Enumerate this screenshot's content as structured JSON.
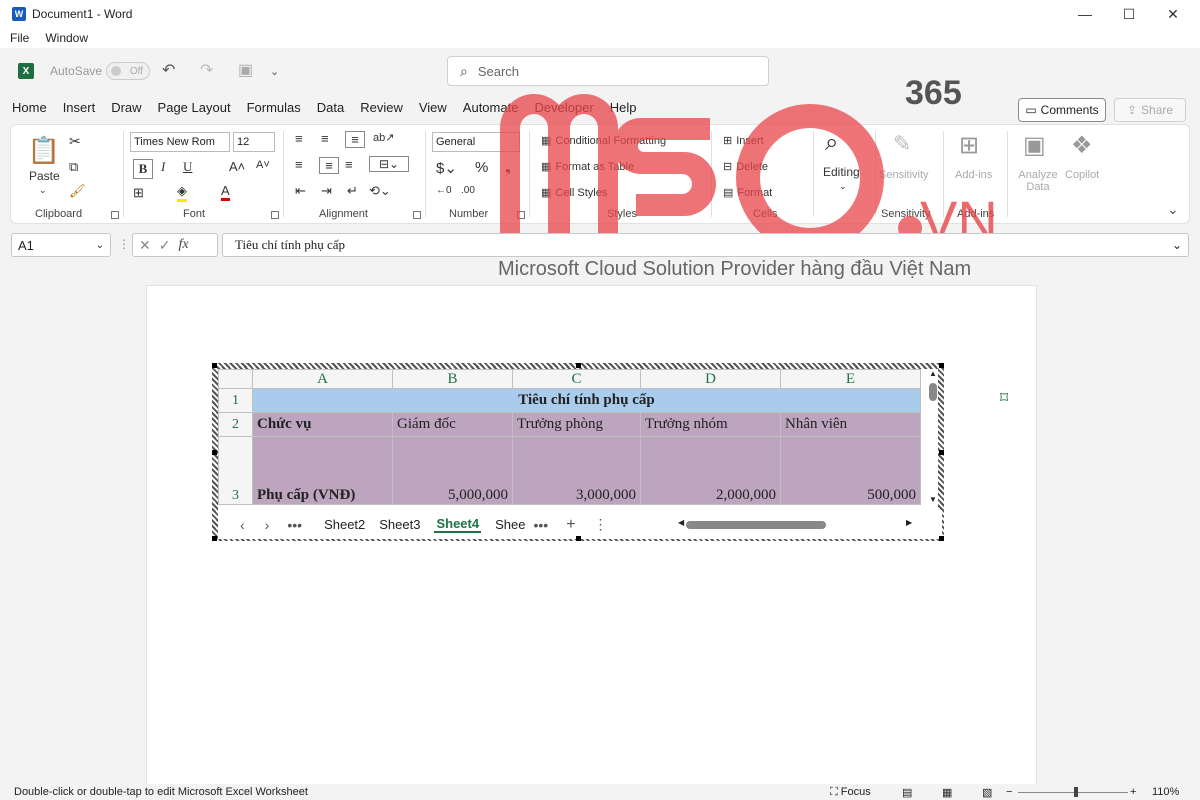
{
  "window": {
    "title": "Document1 - Word",
    "app_letter": "W"
  },
  "menubar": [
    "File",
    "Window"
  ],
  "qat": {
    "autosave": "AutoSave",
    "toggle": "Off",
    "excel_letter": "X"
  },
  "search": {
    "placeholder": "Search"
  },
  "tabs": [
    "Home",
    "Insert",
    "Draw",
    "Page Layout",
    "Formulas",
    "Data",
    "Review",
    "View",
    "Automate",
    "Developer",
    "Help"
  ],
  "comments_label": "Comments",
  "share_label": "Share",
  "ribbon": {
    "clipboard": {
      "paste": "Paste",
      "label": "Clipboard"
    },
    "font": {
      "name": "Times New Rom",
      "size": "12",
      "label": "Font"
    },
    "alignment": {
      "label": "Alignment"
    },
    "number": {
      "format": "General",
      "label": "Number"
    },
    "styles": {
      "cond": "Conditional Formatting",
      "table": "Format as Table",
      "cell": "Cell Styles",
      "label": "Styles"
    },
    "cells": {
      "insert": "Insert",
      "delete": "Delete",
      "format": "Format",
      "label": "Cells"
    },
    "editing": {
      "label": "Editing"
    },
    "sensitivity": {
      "btn": "Sensitivity",
      "label": "Sensitivity"
    },
    "addins": {
      "btn": "Add-ins",
      "label": "Add-ins"
    },
    "analyze": "Analyze Data",
    "copilot": "Copilot"
  },
  "formula_bar": {
    "namebox": "A1",
    "fx": "fx",
    "content": "Tiêu chí tính phụ cấp"
  },
  "watermark": {
    "brand": "mso.vn",
    "suffix": "365",
    "tagline": "Microsoft Cloud Solution Provider hàng đầu Việt Nam"
  },
  "sheet": {
    "columns": [
      "A",
      "B",
      "C",
      "D",
      "E"
    ],
    "rows": [
      "1",
      "2",
      "3"
    ],
    "title": "Tiêu chí tính phụ cấp",
    "header_row": [
      "Chức vụ",
      "Giám đốc",
      "Trưởng phòng",
      "Trưởng nhóm",
      "Nhân viên"
    ],
    "data_row": [
      "Phụ cấp (VNĐ)",
      "5,000,000",
      "3,000,000",
      "2,000,000",
      "500,000"
    ],
    "tabs": [
      "Sheet2",
      "Sheet3",
      "Sheet4",
      "Shee"
    ],
    "active_tab": "Sheet4"
  },
  "status": {
    "message": "Double-click or double-tap to edit Microsoft Excel Worksheet",
    "focus": "Focus",
    "zoom": "110%"
  }
}
